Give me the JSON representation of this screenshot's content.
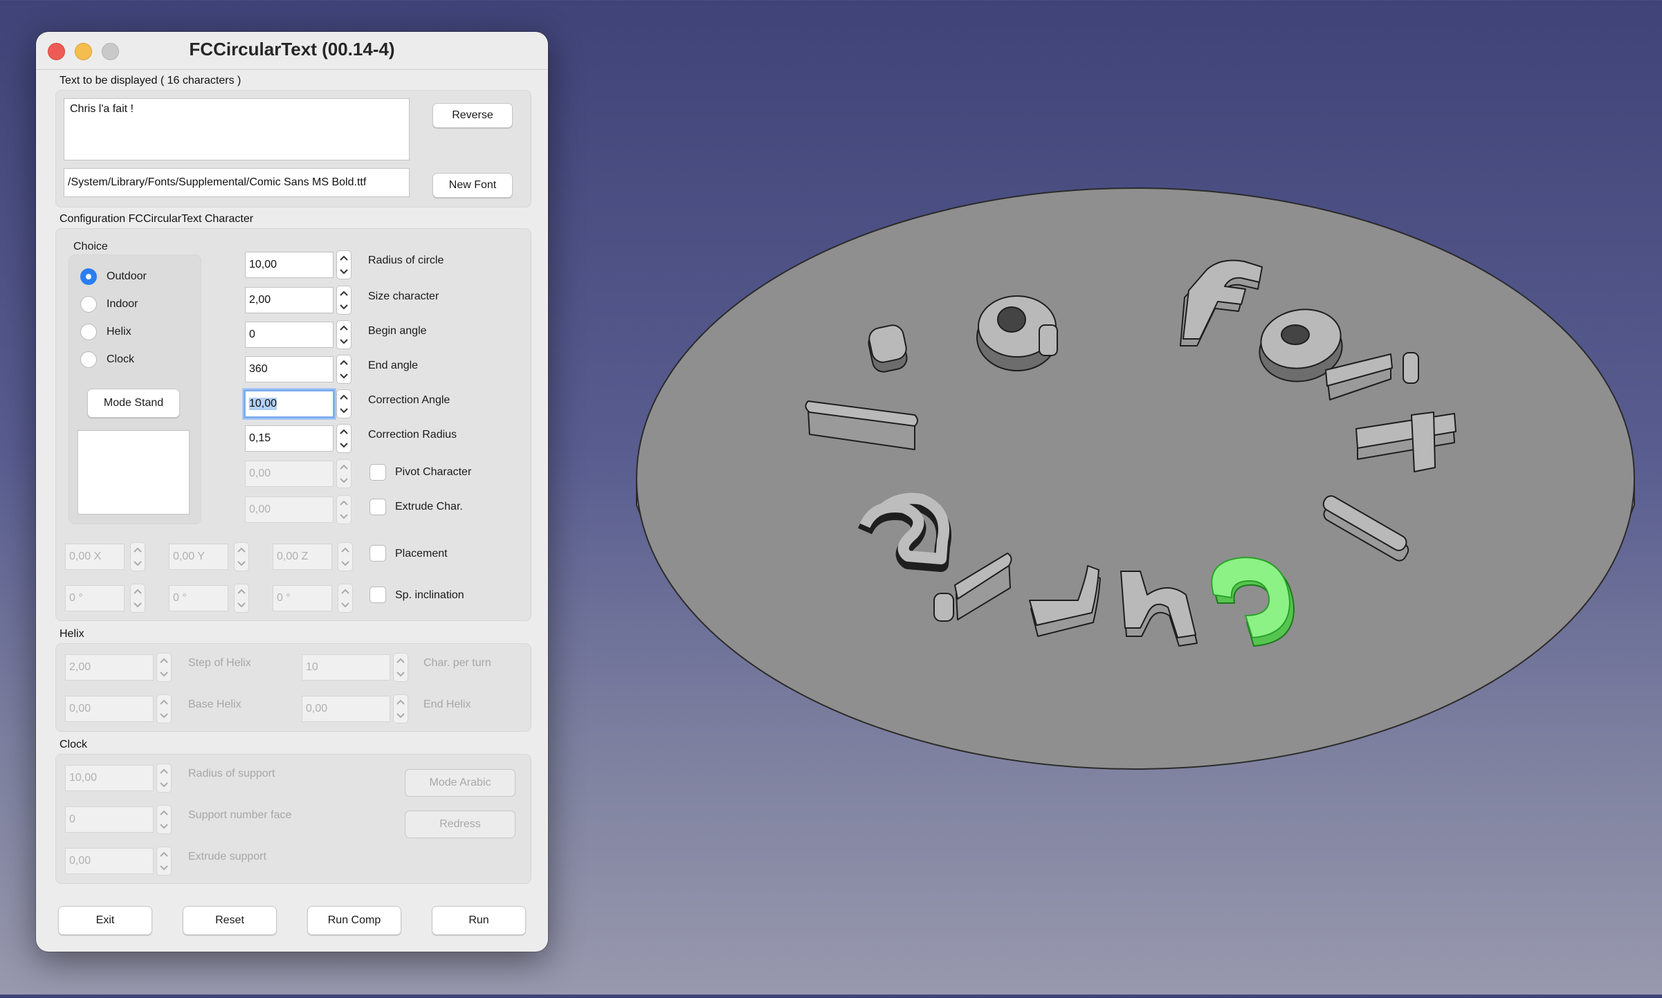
{
  "window": {
    "title": "FCCircularText (00.14-4)"
  },
  "text_section": {
    "header": "Text to be displayed  ( 16 characters )",
    "text_value": "Chris l'a fait !",
    "font_path": "/System/Library/Fonts/Supplemental/Comic Sans MS Bold.ttf",
    "reverse_label": "Reverse",
    "new_font_label": "New Font"
  },
  "config": {
    "header": "Configuration FCCircularText Character",
    "choice": {
      "label": "Choice",
      "options": [
        "Outdoor",
        "Indoor",
        "Helix",
        "Clock"
      ],
      "selected": "Outdoor",
      "mode_stand_label": "Mode Stand"
    },
    "params": [
      {
        "value": "10,00",
        "label": "Radius of circle"
      },
      {
        "value": "2,00",
        "label": "Size character"
      },
      {
        "value": "0",
        "label": "Begin angle"
      },
      {
        "value": "360",
        "label": "End angle"
      },
      {
        "value": "10,00",
        "label": "Correction Angle"
      },
      {
        "value": "0,15",
        "label": "Correction Radius"
      },
      {
        "value": "0,00",
        "label": "Pivot Character"
      },
      {
        "value": "0,00",
        "label": "Extrude Char."
      }
    ],
    "placement": {
      "x": "0,00 X",
      "y": "0,00 Y",
      "z": "0,00 Z",
      "label": "Placement"
    },
    "inclination": {
      "a": "0 °",
      "b": "0 °",
      "c": "0 °",
      "label": "Sp. inclination"
    }
  },
  "helix": {
    "header": "Helix",
    "step_value": "2,00",
    "step_label": "Step of Helix",
    "char_turn_value": "10",
    "char_turn_label": "Char. per turn",
    "base_value": "0,00",
    "base_label": "Base Helix",
    "end_value": "0,00",
    "end_label": "End Helix"
  },
  "clock": {
    "header": "Clock",
    "radius_value": "10,00",
    "radius_label": "Radius of support",
    "face_value": "0",
    "face_label": "Support number face",
    "extrude_value": "0,00",
    "extrude_label": "Extrude support",
    "mode_arabic_label": "Mode Arabic",
    "redress_label": "Redress"
  },
  "footer": {
    "exit": "Exit",
    "reset": "Reset",
    "run_comp": "Run Comp",
    "run": "Run"
  },
  "scene": {
    "letters": [
      "!",
      "a",
      "f",
      "a",
      "i",
      "t",
      "l",
      "C",
      "h",
      "r",
      "i",
      "s",
      "l",
      "'"
    ],
    "highlight_color": "#7cf07a",
    "disc_color": "#8f8f8f"
  }
}
